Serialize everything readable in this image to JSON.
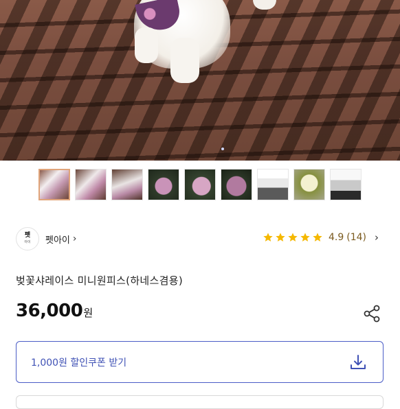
{
  "hero": {
    "image_description": "dog in floral harness on wooden deck"
  },
  "thumbnails": [
    {
      "name": "thumb-1",
      "selected": true
    },
    {
      "name": "thumb-2",
      "selected": false
    },
    {
      "name": "thumb-3",
      "selected": false
    },
    {
      "name": "thumb-4",
      "selected": false
    },
    {
      "name": "thumb-5",
      "selected": false
    },
    {
      "name": "thumb-6",
      "selected": false
    },
    {
      "name": "thumb-7",
      "selected": false
    },
    {
      "name": "thumb-8",
      "selected": false
    },
    {
      "name": "thumb-9",
      "selected": false
    }
  ],
  "seller": {
    "logo_text": "펫",
    "logo_small": "아이",
    "name": "펫아이",
    "chevron": "›"
  },
  "rating": {
    "stars": 5,
    "score": "4.9",
    "count": "(14)",
    "chevron": "›",
    "star_color": "#f5b800"
  },
  "product": {
    "title": "벚꽃샤레이스 미니원피스(하네스겸용)",
    "price": "36,000",
    "currency": "원"
  },
  "coupon": {
    "label": "1,000원 할인쿠폰 받기",
    "accent_color": "#3f51b5",
    "icon": "download-icon"
  },
  "share": {
    "icon": "share-icon"
  }
}
